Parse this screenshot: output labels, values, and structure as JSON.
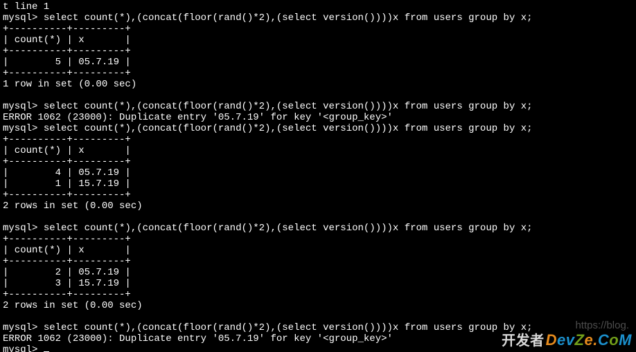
{
  "topLineFragment": "t line 1",
  "prompt": "mysql>",
  "query": "select count(*),(concat(floor(rand()*2),(select version())))x from users group by x;",
  "tableBorder1": "+----------+---------+",
  "headerRow": "| count(*) | x       |",
  "block1": {
    "rows": [
      "|        5 | 05.7.19 |"
    ],
    "footer": "1 row in set (0.00 sec)"
  },
  "errorLine": "ERROR 1062 (23000): Duplicate entry '05.7.19' for key '<group_key>'",
  "block2": {
    "rows": [
      "|        4 | 05.7.19 |",
      "|        1 | 15.7.19 |"
    ],
    "footer": "2 rows in set (0.00 sec)"
  },
  "block3": {
    "rows": [
      "|        2 | 05.7.19 |",
      "|        3 | 15.7.19 |"
    ],
    "footer": "2 rows in set (0.00 sec)"
  },
  "watermarkUrl": "https://blog.",
  "watermarkCN": "开发者",
  "watermarkBrand": {
    "d": "D",
    "ev": "ev",
    "z": "Z",
    "e2": "e",
    "dot": ".",
    "c": "C",
    "o": "o",
    "m": "M"
  }
}
